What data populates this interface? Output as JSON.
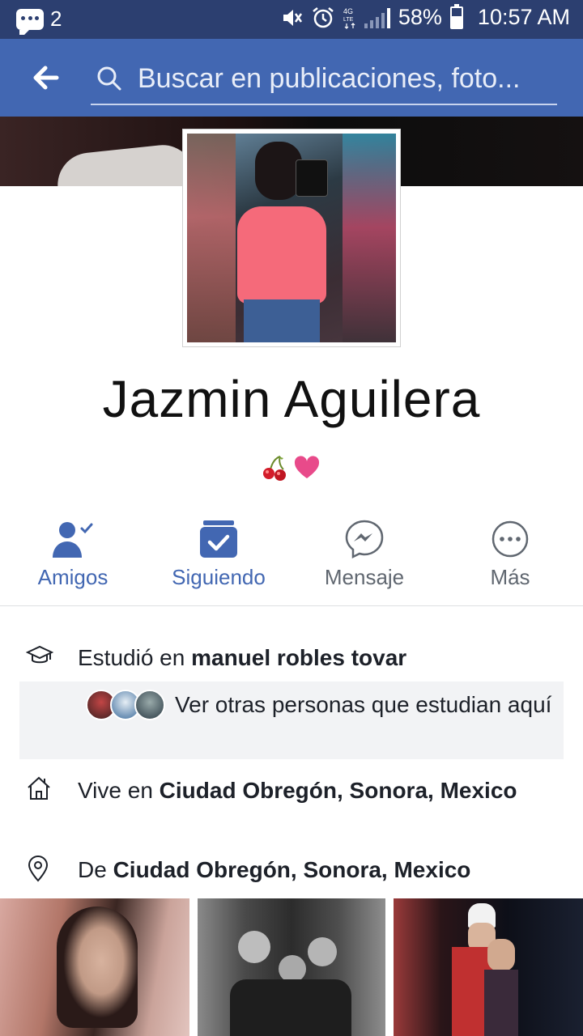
{
  "status_bar": {
    "notification_count": "2",
    "battery": "58%",
    "network": "4G LTE",
    "time": "10:57 AM"
  },
  "appbar": {
    "search_placeholder": "Buscar en publicaciones, foto..."
  },
  "profile": {
    "name": "Jazmin Aguilera",
    "bio_emojis": "🍒❤"
  },
  "actions": [
    {
      "label": "Amigos",
      "icon": "friends-check-icon",
      "active": true
    },
    {
      "label": "Siguiendo",
      "icon": "following-check-icon",
      "active": true
    },
    {
      "label": "Mensaje",
      "icon": "messenger-icon",
      "active": false
    },
    {
      "label": "Más",
      "icon": "more-icon",
      "active": false
    }
  ],
  "details": {
    "studied_prefix": "Estudió en ",
    "studied_place": "manuel robles tovar",
    "classmates_text": "Ver otras personas que estudian aquí",
    "lives_prefix": "Vive en ",
    "lives_place": "Ciudad Obregón, Sonora, Mexico",
    "from_prefix": "De ",
    "from_place": "Ciudad Obregón, Sonora, Mexico"
  },
  "colors": {
    "status_bar": "#2c3f70",
    "app_bar": "#4267b2",
    "accent": "#4267b2"
  }
}
